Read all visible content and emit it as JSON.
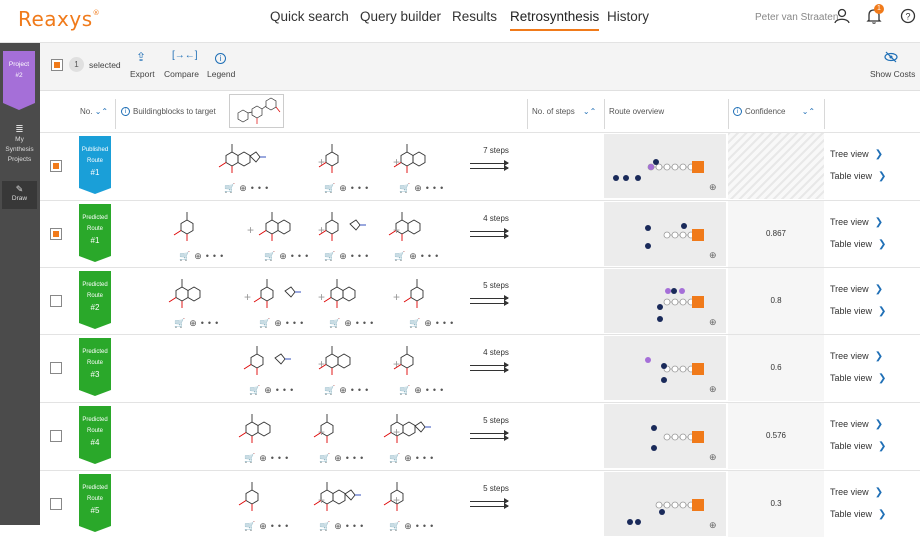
{
  "header": {
    "logo": "Reaxys",
    "nav": [
      "Quick search",
      "Query builder",
      "Results",
      "Retrosynthesis",
      "History"
    ],
    "active_nav": "Retrosynthesis",
    "user": "Peter van Straaten",
    "notification_count": "1"
  },
  "leftnav": {
    "project_label": "Project",
    "project_num": "#2",
    "my_synthesis": "My Synthesis Projects",
    "draw": "Draw"
  },
  "toolbar": {
    "selected_count": "1",
    "selected_label": "selected",
    "export": "Export",
    "compare": "Compare",
    "legend": "Legend",
    "show_costs": "Show Costs"
  },
  "columns": {
    "no": "No.",
    "buildingblocks": "Buildingblocks to target",
    "steps": "No. of steps",
    "overview": "Route overview",
    "confidence": "Confidence"
  },
  "rows": [
    {
      "type": "Published",
      "route": "Route",
      "num": "#1",
      "steps": "7 steps",
      "confidence": "",
      "checked": true,
      "color": "#1a9fd8"
    },
    {
      "type": "Predicted",
      "route": "Route",
      "num": "#1",
      "steps": "4 steps",
      "confidence": "0.867",
      "checked": true,
      "color": "#2aa82a"
    },
    {
      "type": "Predicted",
      "route": "Route",
      "num": "#2",
      "steps": "5 steps",
      "confidence": "0.8",
      "checked": false,
      "color": "#2aa82a"
    },
    {
      "type": "Predicted",
      "route": "Route",
      "num": "#3",
      "steps": "4 steps",
      "confidence": "0.6",
      "checked": false,
      "color": "#2aa82a"
    },
    {
      "type": "Predicted",
      "route": "Route",
      "num": "#4",
      "steps": "5 steps",
      "confidence": "0.576",
      "checked": false,
      "color": "#2aa82a"
    },
    {
      "type": "Predicted",
      "route": "Route",
      "num": "#5",
      "steps": "5 steps",
      "confidence": "0.3",
      "checked": false,
      "color": "#2aa82a"
    }
  ],
  "links": {
    "tree": "Tree view",
    "table": "Table view"
  },
  "colors": {
    "accent": "#f07a1a",
    "link": "#1f6fb6",
    "purple": "#a56fd8",
    "navy": "#1a2a5a"
  }
}
